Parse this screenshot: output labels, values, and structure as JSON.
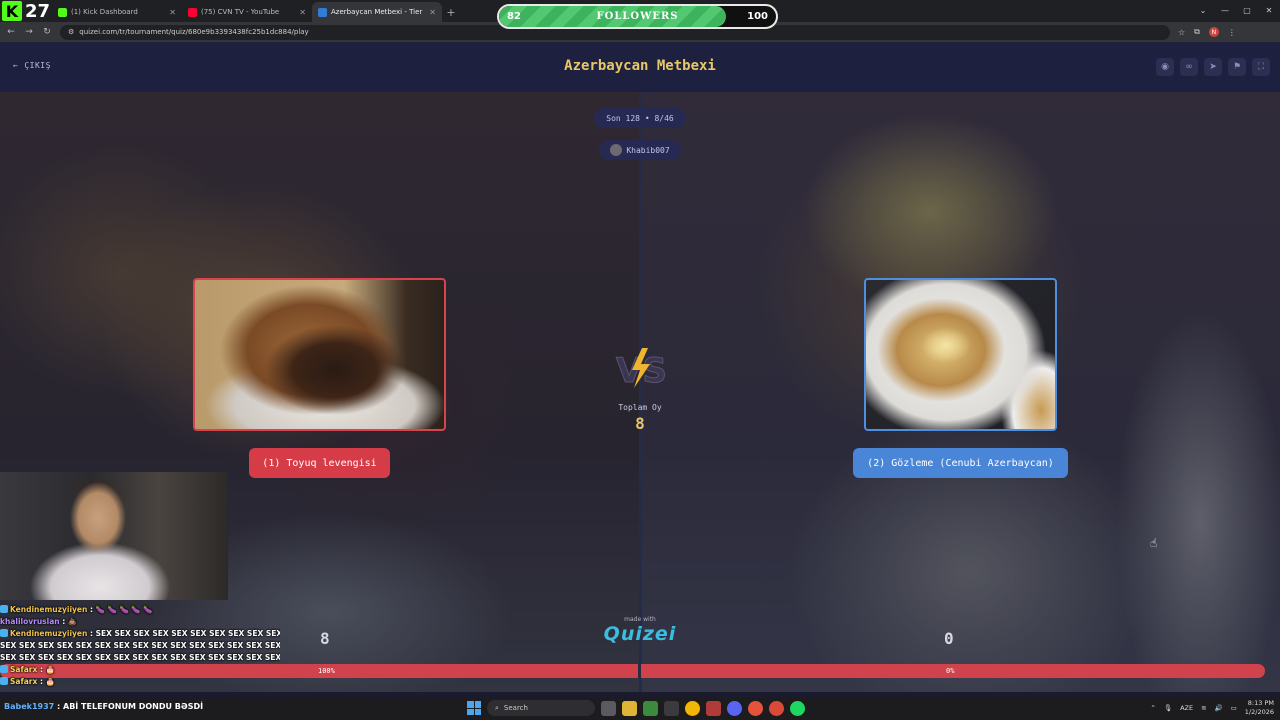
{
  "browser": {
    "tabs": [
      {
        "title": "(1) Kick Dashboard",
        "color": "#53fc18"
      },
      {
        "title": "(75) CVN TV - YouTube",
        "color": "#ff0033"
      },
      {
        "title": "Azerbaycan Metbexi - Tier List",
        "color": "#2f7dd8",
        "active": true
      }
    ],
    "new_tab_icon": "+",
    "url": "quizei.com/tr/tournament/quiz/680e9b3393438fc25b1dc884/play",
    "profile_initial": "N"
  },
  "overlay": {
    "kick_logo": "K",
    "kick_number": "27",
    "followers": {
      "current": "82",
      "label": "FOLLOWERS",
      "goal": "100",
      "progress": 0.82
    }
  },
  "app": {
    "exit_label": "ÇIKIŞ",
    "title": "Azerbaycan Metbexi",
    "round_label": "Son 128 • 8/46",
    "user_name": "Khabib007",
    "total_label": "Toplam Oy",
    "total_value": "8",
    "made_with": "made with",
    "brand": "Quizei",
    "choices": [
      {
        "label": "(1) Toyuq levengisi",
        "votes": "8",
        "percent": "100%",
        "color": "#d63c47",
        "image": "roast-chicken"
      },
      {
        "label": "(2) Gözleme (Cenubi Azerbaycan)",
        "votes": "0",
        "percent": "0%",
        "color": "#4a86d8",
        "image": "gozleme"
      }
    ],
    "vote_share": 1.0
  },
  "chat": [
    {
      "user": "Kendinemuzyiiyen",
      "msg": " : 🍆 🍆 🍆 🍆 🍆",
      "cls": "u1",
      "badge": true
    },
    {
      "user": "khalilovruslan",
      "msg": " : 💩",
      "cls": "u2",
      "badge": false
    },
    {
      "user": "Kendinemuzyiiyen",
      "msg": " : SEX SEX SEX SEX SEX SEX SEX SEX SEX SEX",
      "cls": "u1",
      "badge": true
    },
    {
      "user": "",
      "msg": "SEX SEX SEX SEX SEX SEX SEX SEX SEX SEX SEX SEX SEX SEX SEX",
      "cls": "",
      "badge": false
    },
    {
      "user": "",
      "msg": "SEX SEX SEX SEX SEX SEX SEX SEX SEX SEX SEX SEX SEX SEX SEX",
      "cls": "",
      "badge": false
    },
    {
      "user": "Safarx",
      "msg": " : 🎂",
      "cls": "u3",
      "badge": true
    },
    {
      "user": "Safarx",
      "msg": " : 🎂",
      "cls": "u3",
      "badge": true
    }
  ],
  "taskbar": {
    "last_chat_user": "Babek1937",
    "last_chat_msg": " : ABİ TELEFONUM DONDU BƏSDİ",
    "search_placeholder": "Search",
    "lang": "AZE",
    "time": "8:13 PM",
    "date": "1/2/2026"
  }
}
